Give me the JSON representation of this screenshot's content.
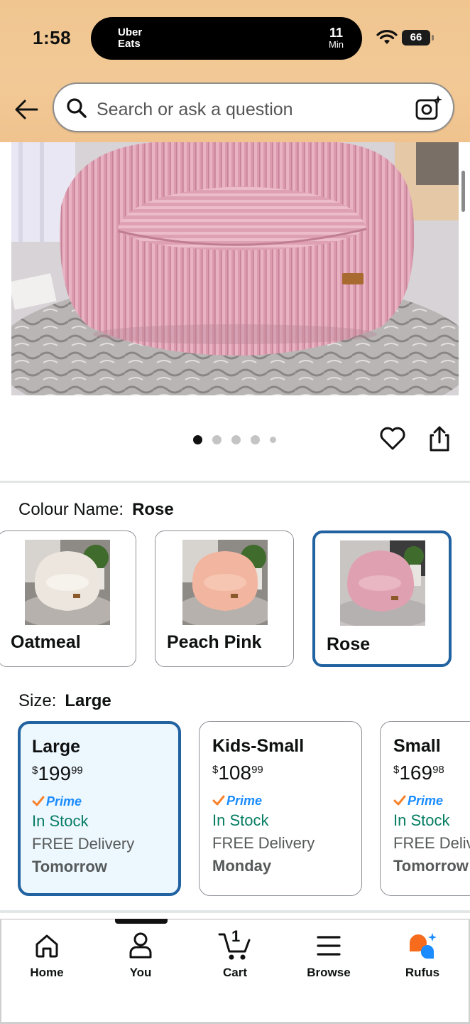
{
  "status_bar": {
    "time": "1:58",
    "live_activity": {
      "app": "Uber\nEats",
      "app_line1": "Uber",
      "app_line2": "Eats",
      "eta_value": "11",
      "eta_unit": "Min"
    },
    "battery": "66"
  },
  "header": {
    "search_placeholder": "Search or ask a question",
    "back_icon": "arrow-left-icon",
    "camera_icon": "camera-scan-icon",
    "background_color": "#f0c590"
  },
  "gallery": {
    "image_count": 5,
    "active_index": 0,
    "subject": "pink corduroy bean bag chair"
  },
  "colour": {
    "label": "Colour Name:",
    "selected": "Rose",
    "options": [
      {
        "name": "Oatmeal",
        "swatch": "#ece6de"
      },
      {
        "name": "Peach Pink",
        "swatch": "#f2b6a0"
      },
      {
        "name": "Rose",
        "swatch": "#dfa1b1"
      }
    ]
  },
  "size": {
    "label": "Size:",
    "selected": "Large",
    "options": [
      {
        "name": "Large",
        "currency": "$",
        "whole": "199",
        "cents": "99",
        "prime": "Prime",
        "stock": "In Stock",
        "delivery": "FREE Delivery",
        "when": "Tomorrow"
      },
      {
        "name": "Kids-Small",
        "currency": "$",
        "whole": "108",
        "cents": "99",
        "prime": "Prime",
        "stock": "In Stock",
        "delivery": "FREE Delivery",
        "when": "Monday"
      },
      {
        "name": "Small",
        "currency": "$",
        "whole": "169",
        "cents": "98",
        "prime": "Prime",
        "stock": "In Stock",
        "delivery": "FREE Delivery",
        "when": "Tomorrow"
      }
    ]
  },
  "bottom_nav": {
    "cart_count": "1",
    "items": [
      {
        "label": "Home",
        "icon": "home-icon"
      },
      {
        "label": "You",
        "icon": "person-icon"
      },
      {
        "label": "Cart",
        "icon": "cart-icon"
      },
      {
        "label": "Browse",
        "icon": "menu-icon"
      },
      {
        "label": "Rufus",
        "icon": "rufus-icon"
      }
    ],
    "active": "You"
  },
  "colors": {
    "selected_border": "#2162a1",
    "selected_bg": "#edf7fe",
    "in_stock": "#067d62",
    "prime_blue": "#1a8cff",
    "prime_check": "#f7812b"
  }
}
